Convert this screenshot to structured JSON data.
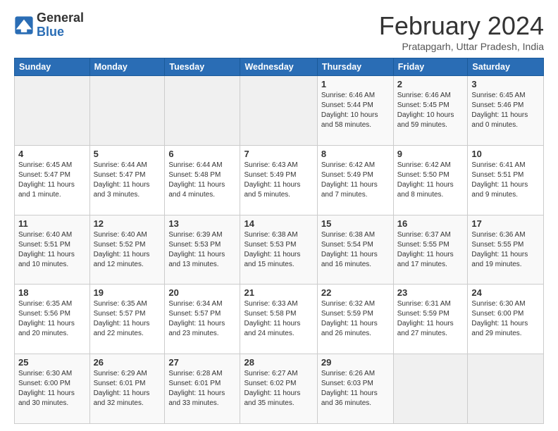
{
  "logo": {
    "general": "General",
    "blue": "Blue"
  },
  "header": {
    "month": "February 2024",
    "location": "Pratapgarh, Uttar Pradesh, India"
  },
  "days_header": [
    "Sunday",
    "Monday",
    "Tuesday",
    "Wednesday",
    "Thursday",
    "Friday",
    "Saturday"
  ],
  "weeks": [
    [
      {
        "day": "",
        "info": ""
      },
      {
        "day": "",
        "info": ""
      },
      {
        "day": "",
        "info": ""
      },
      {
        "day": "",
        "info": ""
      },
      {
        "day": "1",
        "info": "Sunrise: 6:46 AM\nSunset: 5:44 PM\nDaylight: 10 hours and 58 minutes."
      },
      {
        "day": "2",
        "info": "Sunrise: 6:46 AM\nSunset: 5:45 PM\nDaylight: 10 hours and 59 minutes."
      },
      {
        "day": "3",
        "info": "Sunrise: 6:45 AM\nSunset: 5:46 PM\nDaylight: 11 hours and 0 minutes."
      }
    ],
    [
      {
        "day": "4",
        "info": "Sunrise: 6:45 AM\nSunset: 5:47 PM\nDaylight: 11 hours and 1 minute."
      },
      {
        "day": "5",
        "info": "Sunrise: 6:44 AM\nSunset: 5:47 PM\nDaylight: 11 hours and 3 minutes."
      },
      {
        "day": "6",
        "info": "Sunrise: 6:44 AM\nSunset: 5:48 PM\nDaylight: 11 hours and 4 minutes."
      },
      {
        "day": "7",
        "info": "Sunrise: 6:43 AM\nSunset: 5:49 PM\nDaylight: 11 hours and 5 minutes."
      },
      {
        "day": "8",
        "info": "Sunrise: 6:42 AM\nSunset: 5:49 PM\nDaylight: 11 hours and 7 minutes."
      },
      {
        "day": "9",
        "info": "Sunrise: 6:42 AM\nSunset: 5:50 PM\nDaylight: 11 hours and 8 minutes."
      },
      {
        "day": "10",
        "info": "Sunrise: 6:41 AM\nSunset: 5:51 PM\nDaylight: 11 hours and 9 minutes."
      }
    ],
    [
      {
        "day": "11",
        "info": "Sunrise: 6:40 AM\nSunset: 5:51 PM\nDaylight: 11 hours and 10 minutes."
      },
      {
        "day": "12",
        "info": "Sunrise: 6:40 AM\nSunset: 5:52 PM\nDaylight: 11 hours and 12 minutes."
      },
      {
        "day": "13",
        "info": "Sunrise: 6:39 AM\nSunset: 5:53 PM\nDaylight: 11 hours and 13 minutes."
      },
      {
        "day": "14",
        "info": "Sunrise: 6:38 AM\nSunset: 5:53 PM\nDaylight: 11 hours and 15 minutes."
      },
      {
        "day": "15",
        "info": "Sunrise: 6:38 AM\nSunset: 5:54 PM\nDaylight: 11 hours and 16 minutes."
      },
      {
        "day": "16",
        "info": "Sunrise: 6:37 AM\nSunset: 5:55 PM\nDaylight: 11 hours and 17 minutes."
      },
      {
        "day": "17",
        "info": "Sunrise: 6:36 AM\nSunset: 5:55 PM\nDaylight: 11 hours and 19 minutes."
      }
    ],
    [
      {
        "day": "18",
        "info": "Sunrise: 6:35 AM\nSunset: 5:56 PM\nDaylight: 11 hours and 20 minutes."
      },
      {
        "day": "19",
        "info": "Sunrise: 6:35 AM\nSunset: 5:57 PM\nDaylight: 11 hours and 22 minutes."
      },
      {
        "day": "20",
        "info": "Sunrise: 6:34 AM\nSunset: 5:57 PM\nDaylight: 11 hours and 23 minutes."
      },
      {
        "day": "21",
        "info": "Sunrise: 6:33 AM\nSunset: 5:58 PM\nDaylight: 11 hours and 24 minutes."
      },
      {
        "day": "22",
        "info": "Sunrise: 6:32 AM\nSunset: 5:59 PM\nDaylight: 11 hours and 26 minutes."
      },
      {
        "day": "23",
        "info": "Sunrise: 6:31 AM\nSunset: 5:59 PM\nDaylight: 11 hours and 27 minutes."
      },
      {
        "day": "24",
        "info": "Sunrise: 6:30 AM\nSunset: 6:00 PM\nDaylight: 11 hours and 29 minutes."
      }
    ],
    [
      {
        "day": "25",
        "info": "Sunrise: 6:30 AM\nSunset: 6:00 PM\nDaylight: 11 hours and 30 minutes."
      },
      {
        "day": "26",
        "info": "Sunrise: 6:29 AM\nSunset: 6:01 PM\nDaylight: 11 hours and 32 minutes."
      },
      {
        "day": "27",
        "info": "Sunrise: 6:28 AM\nSunset: 6:01 PM\nDaylight: 11 hours and 33 minutes."
      },
      {
        "day": "28",
        "info": "Sunrise: 6:27 AM\nSunset: 6:02 PM\nDaylight: 11 hours and 35 minutes."
      },
      {
        "day": "29",
        "info": "Sunrise: 6:26 AM\nSunset: 6:03 PM\nDaylight: 11 hours and 36 minutes."
      },
      {
        "day": "",
        "info": ""
      },
      {
        "day": "",
        "info": ""
      }
    ]
  ]
}
